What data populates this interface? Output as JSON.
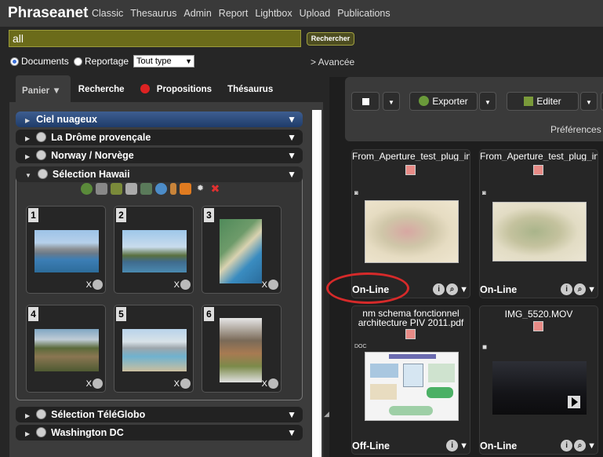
{
  "app": {
    "brand": "Phraseanet"
  },
  "nav": [
    "Classic",
    "Thesaurus",
    "Admin",
    "Report",
    "Lightbox",
    "Upload",
    "Publications"
  ],
  "search": {
    "value": "all",
    "button": "Rechercher",
    "advanced": "> Avancée"
  },
  "search_mode": {
    "documents": "Documents",
    "reportage": "Reportage",
    "type_selected": "Tout type",
    "selected_option": "documents"
  },
  "left_tabs": {
    "basket": "Panier",
    "search": "Recherche",
    "proposals": "Propositions",
    "thesaurus": "Thésaurus"
  },
  "baskets": [
    {
      "name": "Ciel nuageux",
      "style": "blue"
    },
    {
      "name": "La Drôme provençale"
    },
    {
      "name": "Norway / Norvège"
    },
    {
      "name": "Sélection Hawaii",
      "expanded": true
    },
    {
      "name": "Sélection TéléGlobo"
    },
    {
      "name": "Washington DC"
    }
  ],
  "hawaii_items": [
    {
      "num": "1",
      "remove": "X"
    },
    {
      "num": "2",
      "remove": "X"
    },
    {
      "num": "3",
      "remove": "X"
    },
    {
      "num": "4",
      "remove": "X"
    },
    {
      "num": "5",
      "remove": "X"
    },
    {
      "num": "6",
      "remove": "X"
    }
  ],
  "toolbar": {
    "export": "Exporter",
    "edit": "Editer",
    "preferences": "Préférences"
  },
  "records": [
    {
      "title": "From_Aperture_test_plug_in",
      "status": "On-Line",
      "type_icon": "camera-icon"
    },
    {
      "title": "From_Aperture_test_plug_in",
      "status": "On-Line",
      "type_icon": "camera-icon"
    },
    {
      "title": "nm schema fonctionnel architecture PIV 2011.pdf",
      "title_line1": "nm schema fonctionnel",
      "title_line2": "architecture PIV 2011.pdf",
      "status": "Off-Line",
      "type_icon": "doc-icon",
      "type_label": "DOC"
    },
    {
      "title": "IMG_5520.MOV",
      "status": "On-Line",
      "type_icon": "video-icon"
    }
  ],
  "colors": {
    "search_bg": "#6b6b1a",
    "highlight": "#d62a2a",
    "blue_basket": "#2f4d7d",
    "flag_red": "#e78b86"
  }
}
